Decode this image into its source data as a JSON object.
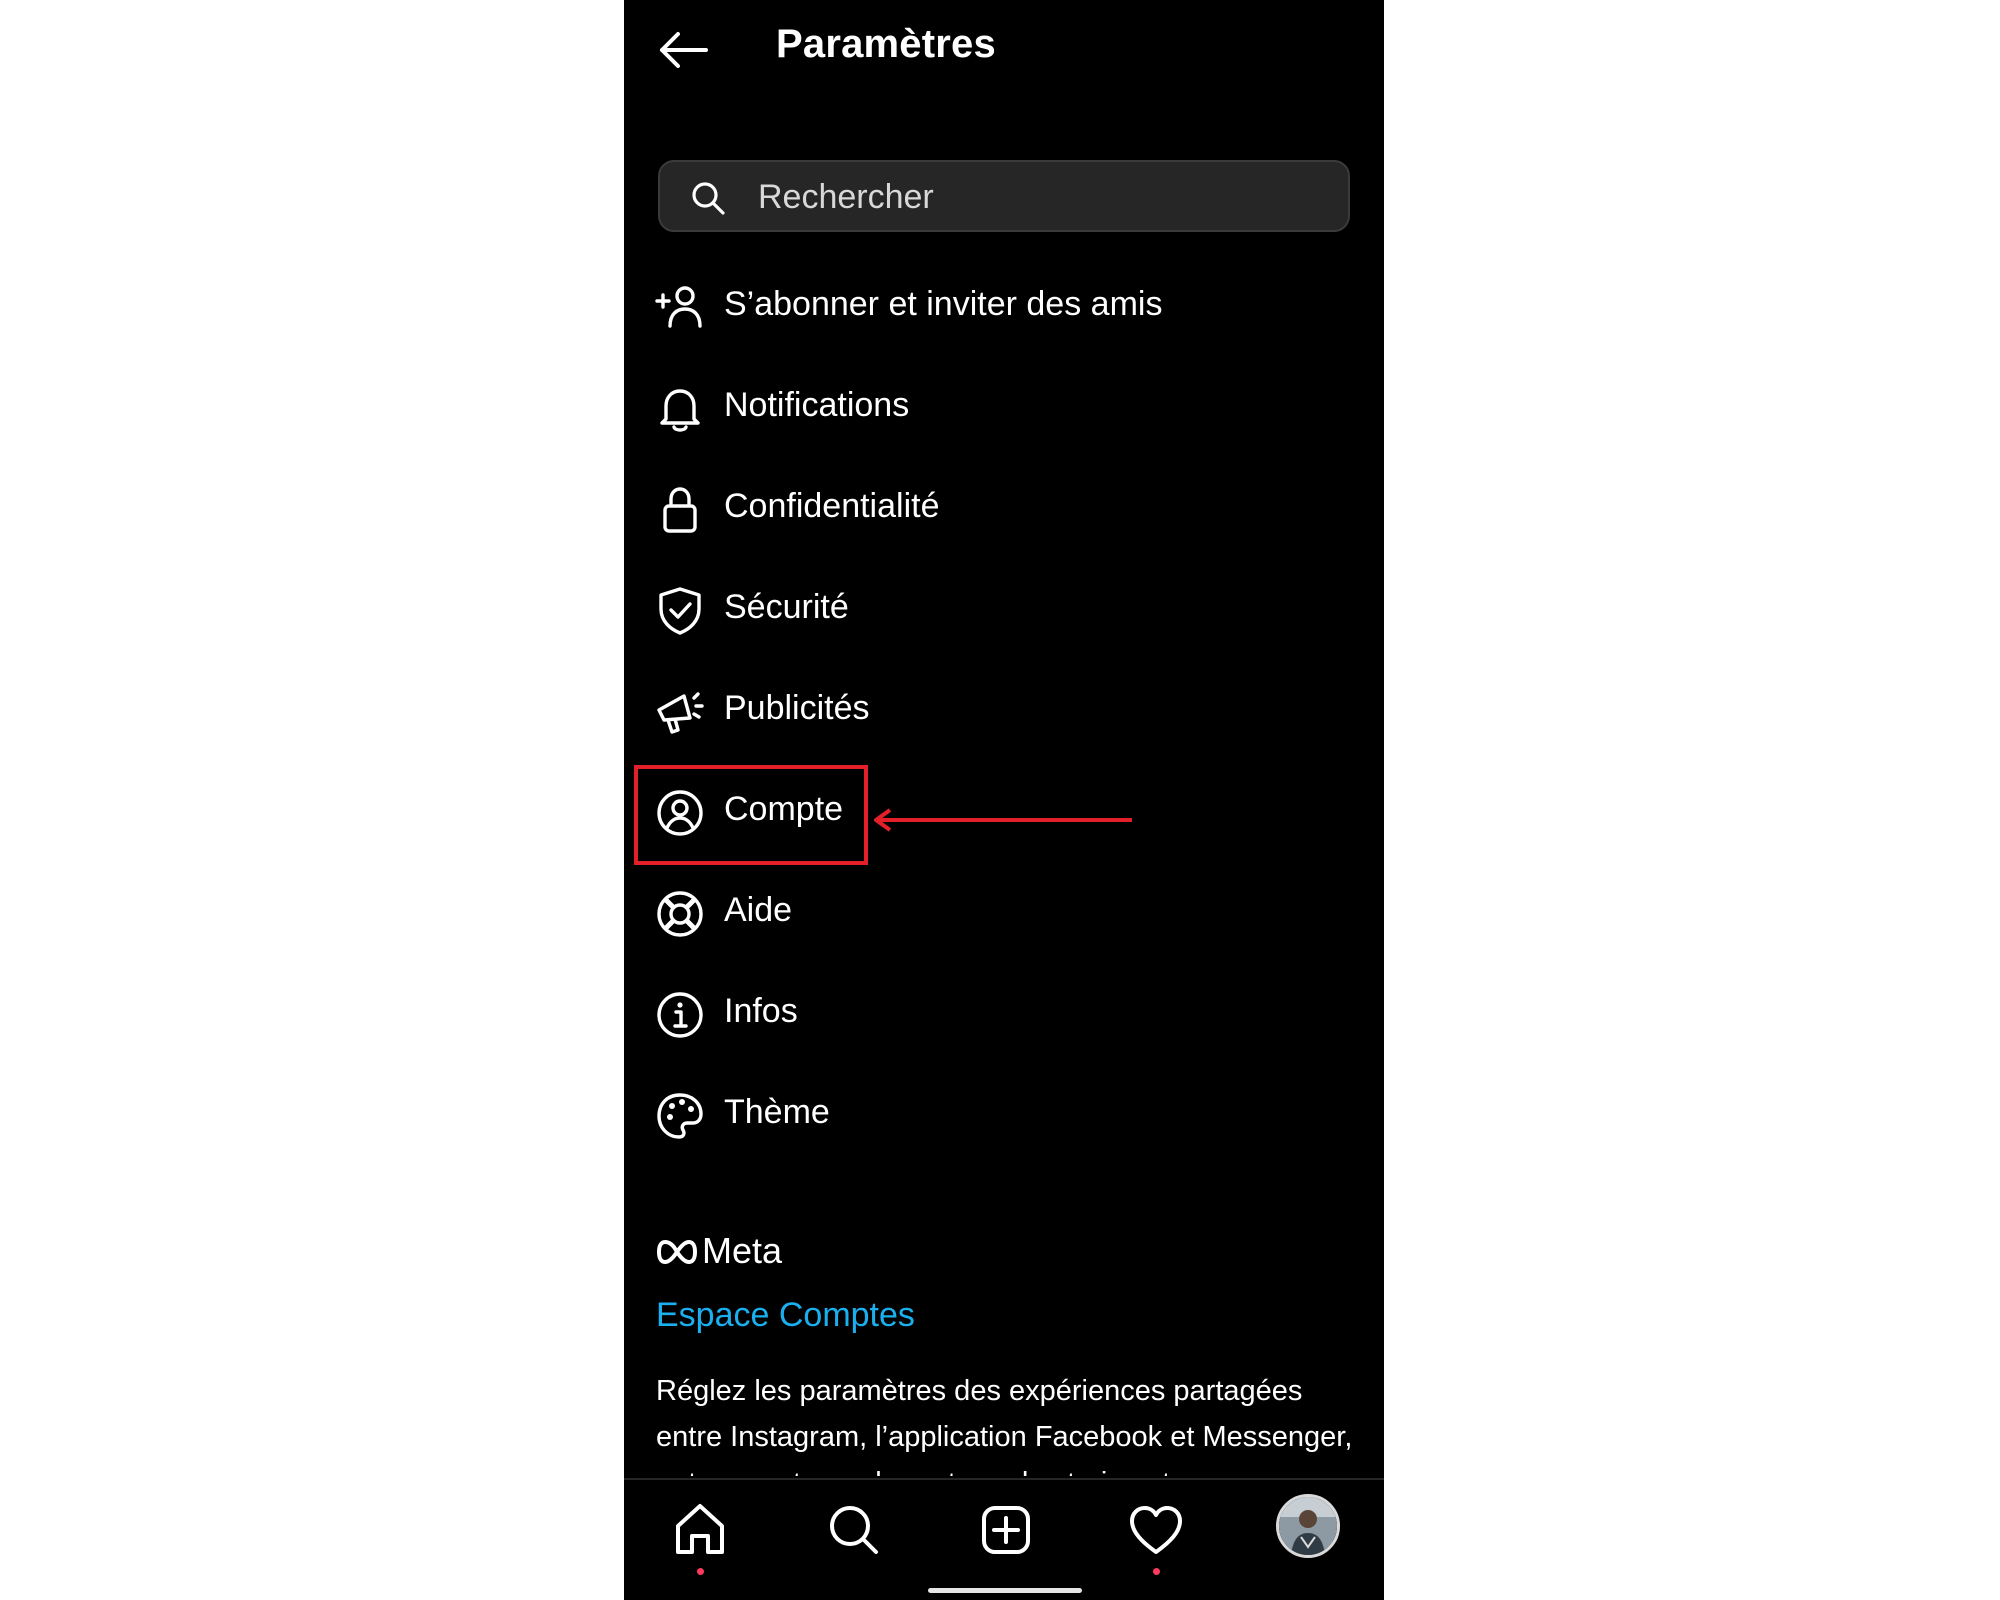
{
  "header": {
    "title": "Paramètres",
    "back_icon": "back-arrow-icon"
  },
  "search": {
    "placeholder": "Rechercher",
    "value": "",
    "icon": "search-icon"
  },
  "menu": {
    "items": [
      {
        "label": "S’abonner et inviter des amis",
        "icon": "add-person-icon"
      },
      {
        "label": "Notifications",
        "icon": "bell-icon"
      },
      {
        "label": "Confidentialité",
        "icon": "lock-icon"
      },
      {
        "label": "Sécurité",
        "icon": "shield-check-icon"
      },
      {
        "label": "Publicités",
        "icon": "megaphone-icon"
      },
      {
        "label": "Compte",
        "icon": "user-circle-icon",
        "highlighted": true
      },
      {
        "label": "Aide",
        "icon": "lifebuoy-icon"
      },
      {
        "label": "Infos",
        "icon": "info-icon"
      },
      {
        "label": "Thème",
        "icon": "palette-icon"
      }
    ]
  },
  "meta_section": {
    "logo_text": "Meta",
    "link": "Espace Comptes",
    "description": "Réglez les paramètres des expériences partagées entre Instagram, l’application Facebook et Messenger, notamment pour le partage de stories et"
  },
  "bottom_nav": {
    "items": [
      "home-icon",
      "search-icon",
      "create-post-icon",
      "heart-icon",
      "profile-avatar"
    ]
  },
  "colors": {
    "background": "#000000",
    "text": "#ffffff",
    "link": "#1ab0ef",
    "annotation": "#e3202a",
    "search_bg": "#262626",
    "notification_dot": "#ff3a5c"
  }
}
